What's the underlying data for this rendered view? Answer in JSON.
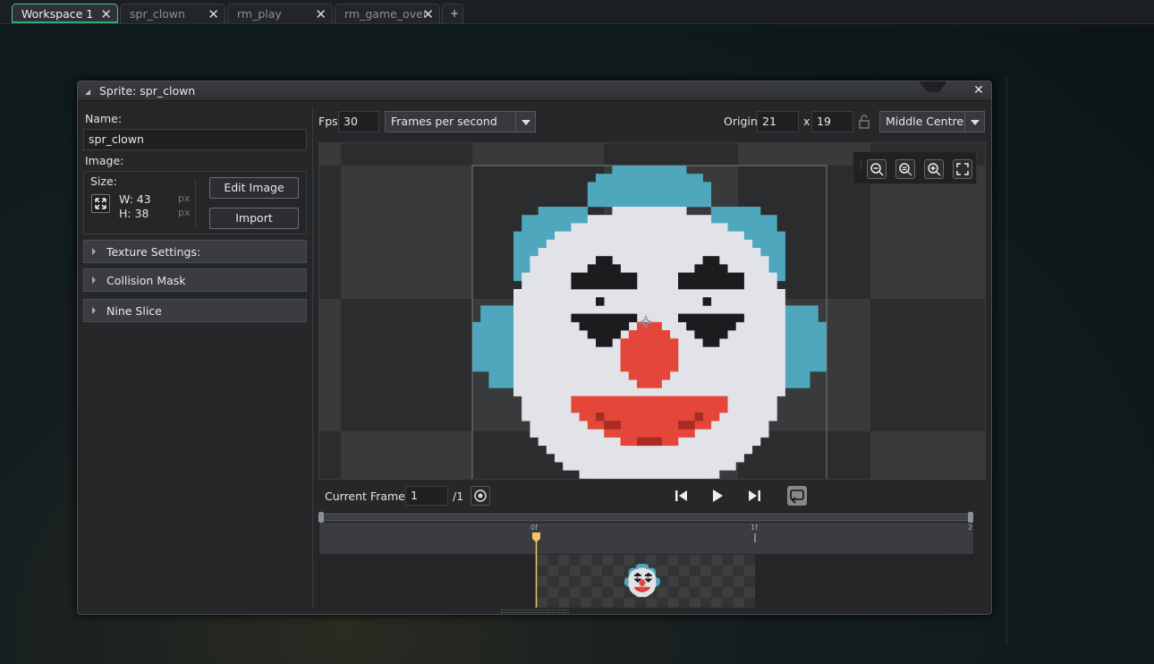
{
  "tabs": [
    {
      "label": "Workspace 1",
      "active": true
    },
    {
      "label": "spr_clown",
      "active": false
    },
    {
      "label": "rm_play",
      "active": false
    },
    {
      "label": "rm_game_over",
      "active": false
    }
  ],
  "tab_add": "+",
  "window": {
    "title": "Sprite: spr_clown",
    "close": "✕"
  },
  "left": {
    "name_label": "Name:",
    "name_value": "spr_clown",
    "image_label": "Image:",
    "size_label": "Size:",
    "width": "W: 43",
    "height": "H: 38",
    "unit": "px",
    "edit_image": "Edit Image",
    "import": "Import",
    "sections": [
      "Texture Settings:",
      "Collision Mask",
      "Nine Slice"
    ]
  },
  "toolbar": {
    "fps_label": "Fps",
    "fps_value": "30",
    "fps_mode": "Frames per second",
    "origin_label": "Origin",
    "origin_x": "21",
    "origin_sep": "x",
    "origin_y": "19",
    "origin_mode": "Middle Centre"
  },
  "zoom_icons": [
    "zoom-out-icon",
    "zoom-reset-icon",
    "zoom-in-icon",
    "fullscreen-icon"
  ],
  "frame": {
    "label": "Current Frame:",
    "value": "1",
    "total": "/1"
  },
  "timeline": {
    "markers": [
      "0f",
      "1f",
      "2"
    ]
  },
  "colors": {
    "accent": "#2fae72",
    "clown_blue": "#4fa7bd",
    "clown_white": "#e2e3e8",
    "clown_red": "#e5463a",
    "clown_dark_red": "#a82c26",
    "clown_black": "#1c1c1e",
    "playhead": "#f5c26b"
  }
}
